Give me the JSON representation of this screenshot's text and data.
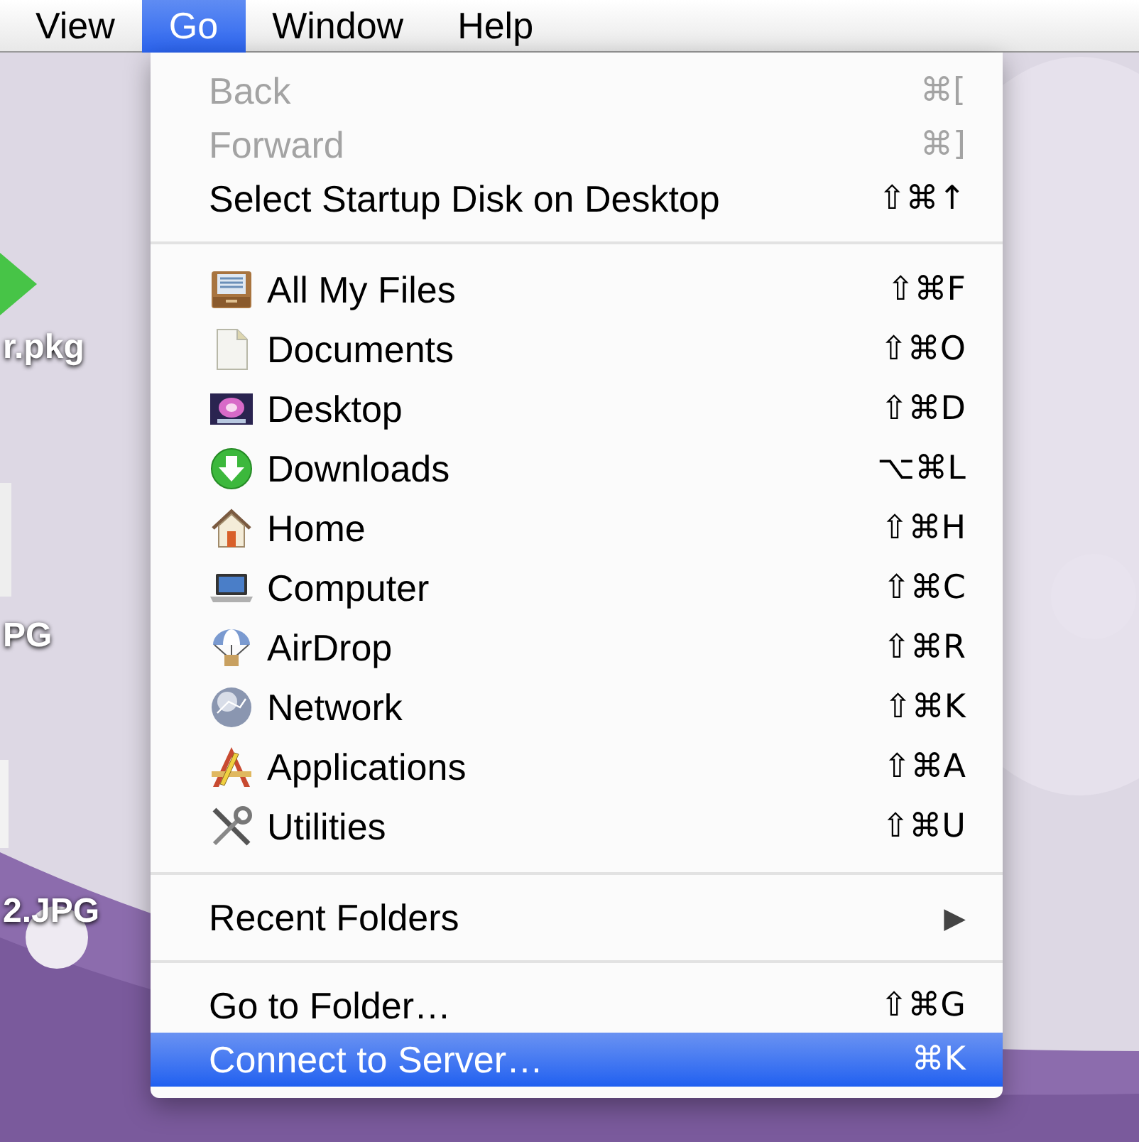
{
  "menu_bar": {
    "items": [
      {
        "label": "View",
        "selected": false
      },
      {
        "label": "Go",
        "selected": true
      },
      {
        "label": "Window",
        "selected": false
      },
      {
        "label": "Help",
        "selected": false
      }
    ]
  },
  "desktop_icons": [
    {
      "label": "r.pkg"
    },
    {
      "label": "PG"
    },
    {
      "label": "2.JPG"
    }
  ],
  "menu": {
    "sections": [
      {
        "items": [
          {
            "kind": "plain",
            "label": "Back",
            "shortcut": "⌘[",
            "disabled": true,
            "selected": false
          },
          {
            "kind": "plain",
            "label": "Forward",
            "shortcut": "⌘]",
            "disabled": true,
            "selected": false
          },
          {
            "kind": "plain",
            "label": "Select Startup Disk on Desktop",
            "shortcut": "⇧⌘↑",
            "disabled": false,
            "selected": false
          }
        ]
      },
      {
        "items": [
          {
            "kind": "place",
            "label": "All My Files",
            "shortcut": "⇧⌘F",
            "disabled": false,
            "selected": false
          },
          {
            "kind": "place",
            "label": "Documents",
            "shortcut": "⇧⌘O",
            "disabled": false,
            "selected": false
          },
          {
            "kind": "place",
            "label": "Desktop",
            "shortcut": "⇧⌘D",
            "disabled": false,
            "selected": false
          },
          {
            "kind": "place",
            "label": "Downloads",
            "shortcut": "⌥⌘L",
            "disabled": false,
            "selected": false
          },
          {
            "kind": "place",
            "label": "Home",
            "shortcut": "⇧⌘H",
            "disabled": false,
            "selected": false
          },
          {
            "kind": "place",
            "label": "Computer",
            "shortcut": "⇧⌘C",
            "disabled": false,
            "selected": false
          },
          {
            "kind": "place",
            "label": "AirDrop",
            "shortcut": "⇧⌘R",
            "disabled": false,
            "selected": false
          },
          {
            "kind": "place",
            "label": "Network",
            "shortcut": "⇧⌘K",
            "disabled": false,
            "selected": false
          },
          {
            "kind": "place",
            "label": "Applications",
            "shortcut": "⇧⌘A",
            "disabled": false,
            "selected": false
          },
          {
            "kind": "place",
            "label": "Utilities",
            "shortcut": "⇧⌘U",
            "disabled": false,
            "selected": false
          }
        ]
      },
      {
        "items": [
          {
            "kind": "submenu",
            "label": "Recent Folders",
            "shortcut": "▶",
            "disabled": false,
            "selected": false
          }
        ]
      },
      {
        "items": [
          {
            "kind": "plain",
            "label": "Go to Folder…",
            "shortcut": "⇧⌘G",
            "disabled": false,
            "selected": false
          },
          {
            "kind": "plain",
            "label": "Connect to Server…",
            "shortcut": "⌘K",
            "disabled": false,
            "selected": true
          }
        ]
      }
    ]
  }
}
